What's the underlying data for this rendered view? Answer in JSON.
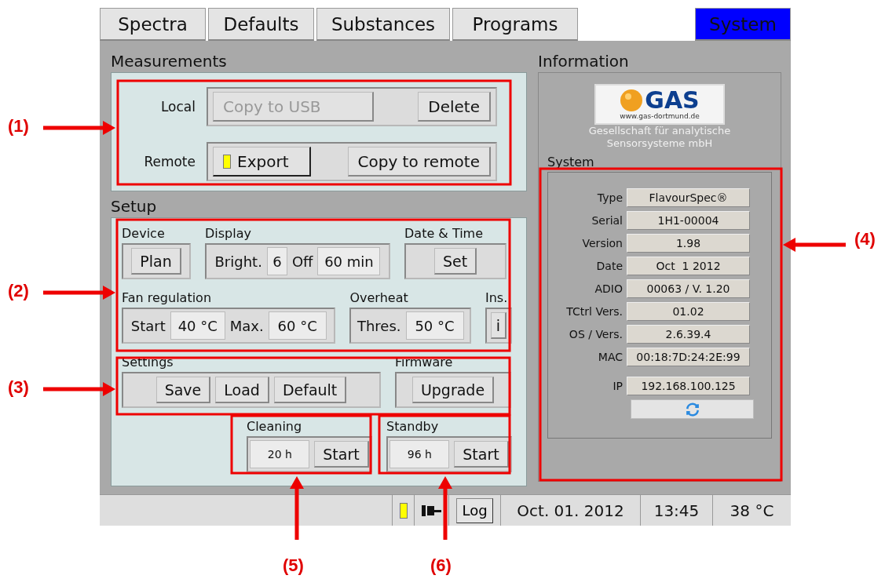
{
  "tabs": [
    {
      "label": "Spectra",
      "selected": false
    },
    {
      "label": "Defaults",
      "selected": false
    },
    {
      "label": "Substances",
      "selected": false
    },
    {
      "label": "Programs",
      "selected": false
    },
    {
      "label": "System",
      "selected": true
    }
  ],
  "measurements": {
    "title": "Measurements",
    "rows": [
      {
        "label": "Local",
        "buttons": [
          {
            "label": "Copy to USB",
            "disabled": true,
            "indicator": false
          },
          {
            "label": "Delete",
            "disabled": false,
            "indicator": false
          }
        ]
      },
      {
        "label": "Remote",
        "buttons": [
          {
            "label": "Export",
            "disabled": false,
            "indicator": true
          },
          {
            "label": "Copy to remote",
            "disabled": false,
            "indicator": false
          }
        ]
      }
    ]
  },
  "setup": {
    "title": "Setup",
    "device": {
      "title": "Device",
      "button": "Plan"
    },
    "display": {
      "title": "Display",
      "fields": [
        {
          "label": "Bright.",
          "value": "6"
        },
        {
          "label": "Off",
          "value": "60 min"
        }
      ]
    },
    "date_time": {
      "title": "Date & Time",
      "button": "Set"
    },
    "fan_regulation": {
      "title": "Fan regulation",
      "fields": [
        {
          "label": "Start",
          "value": "40 °C"
        },
        {
          "label": "Max.",
          "value": "60 °C"
        }
      ]
    },
    "overheat": {
      "title": "Overheat",
      "fields": [
        {
          "label": "Thres.",
          "value": "50 °C"
        }
      ]
    },
    "ins": {
      "title": "Ins.",
      "button": "i"
    },
    "settings": {
      "title": "Settings",
      "buttons": [
        "Save",
        "Load",
        "Default"
      ]
    },
    "firmware": {
      "title": "Firmware",
      "buttons": [
        "Upgrade"
      ]
    },
    "cleaning": {
      "title": "Cleaning",
      "value": "20 h",
      "button": "Start"
    },
    "standby": {
      "title": "Standby",
      "value": "96 h",
      "button": "Start"
    }
  },
  "information": {
    "title": "Information",
    "logo": {
      "name": "GAS",
      "url": "www.gas-dortmund.de"
    },
    "company": [
      "Gesellschaft für analytische",
      "Sensorsysteme mbH"
    ],
    "system": {
      "title": "System",
      "rows": [
        {
          "label": "Type",
          "value": "FlavourSpec®"
        },
        {
          "label": "Serial",
          "value": "1H1-00004"
        },
        {
          "label": "Version",
          "value": "1.98"
        },
        {
          "label": "Date",
          "value": "Oct  1 2012"
        },
        {
          "label": "ADIO",
          "value": "00063 / V. 1.20"
        },
        {
          "label": "TCtrl Vers.",
          "value": "01.02"
        },
        {
          "label": "OS / Vers.",
          "value": "2.6.39.4"
        },
        {
          "label": "MAC",
          "value": "00:18:7D:24:2E:99"
        },
        {
          "label": "IP",
          "value": "192.168.100.125"
        }
      ]
    }
  },
  "status_bar": {
    "log_button": "Log",
    "date": "Oct. 01. 2012",
    "time": "13:45",
    "temperature": "38 °C"
  },
  "annotations": [
    {
      "label": "(1)"
    },
    {
      "label": "(2)"
    },
    {
      "label": "(3)"
    },
    {
      "label": "(4)"
    },
    {
      "label": "(5)"
    },
    {
      "label": "(6)"
    }
  ]
}
